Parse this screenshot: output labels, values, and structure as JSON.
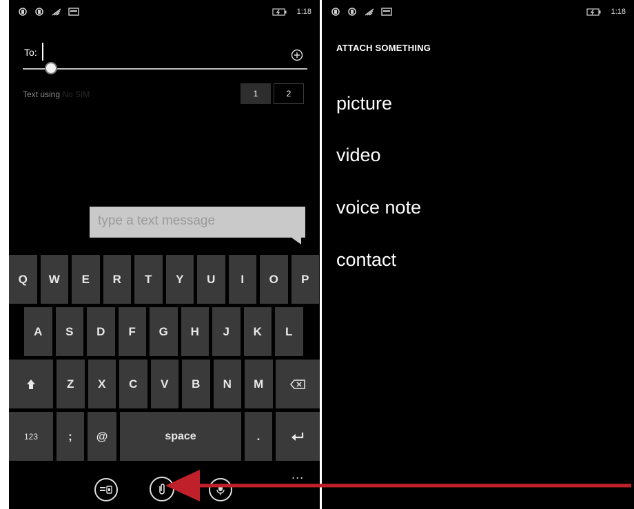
{
  "left_screen": {
    "status_time": "1:18",
    "to_label": "To:",
    "text_using_label": "Text using",
    "text_using_sim": "No SIM",
    "sim_buttons": [
      "1",
      "2"
    ],
    "message_placeholder": "type a text message",
    "keyboard": {
      "row1": [
        "Q",
        "W",
        "E",
        "R",
        "T",
        "Y",
        "U",
        "I",
        "O",
        "P"
      ],
      "row2": [
        "A",
        "S",
        "D",
        "F",
        "G",
        "H",
        "J",
        "K",
        "L"
      ],
      "row3": [
        "Z",
        "X",
        "C",
        "V",
        "B",
        "N",
        "M"
      ],
      "shift_icon": "shift-arrow-up-icon",
      "backspace_icon": "backspace-icon",
      "numbers_label": "123",
      "semicolon_label": ";",
      "at_label": "@",
      "space_label": "space",
      "period_label": ".",
      "enter_icon": "enter-icon"
    },
    "app_bar": {
      "icons": [
        "sim-switch-icon",
        "attach-paperclip-icon",
        "microphone-icon"
      ],
      "more_label": "..."
    }
  },
  "right_screen": {
    "status_time": "1:18",
    "title": "ATTACH SOMETHING",
    "options": [
      "picture",
      "video",
      "voice note",
      "contact"
    ]
  },
  "annotation": {
    "arrow_color": "#c0202a"
  },
  "colors": {
    "background": "#000000",
    "key": "#3a3a3a",
    "message_box": "#c9c9c9"
  }
}
